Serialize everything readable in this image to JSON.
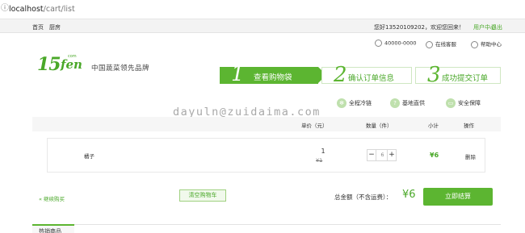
{
  "browser": {
    "url_host": "localhost",
    "url_path": "/cart/list"
  },
  "topnav": {
    "home": "首页",
    "kitchen": "厨房",
    "welcome": "您好13520109202，欢迎您回来！",
    "user_center": "用户中心",
    "logout": "退出"
  },
  "service": {
    "phone": "40000-0000",
    "chat": "在线客服",
    "help": "帮助中心"
  },
  "logo": {
    "number": "15",
    "brand": "fen",
    "domain": "com",
    "slogan": "中国蔬菜领先品牌"
  },
  "steps": [
    {
      "num": "1",
      "label": "查看购物袋"
    },
    {
      "num": "2",
      "label": "确认订单信息"
    },
    {
      "num": "3",
      "label": "成功提交订单"
    }
  ],
  "features": {
    "cold_chain": "全程冷链",
    "farm_direct": "基地直供",
    "safety": "安全保障"
  },
  "watermark": "dayuln@zuidaima.com",
  "table": {
    "headers": {
      "price": "单价（元）",
      "qty": "数量（件）",
      "subtotal": "小计",
      "op": "操作"
    },
    "rows": [
      {
        "name": "橘子",
        "price": "1",
        "original_price": "¥1",
        "qty": "6",
        "subtotal": "¥6",
        "delete": "删除"
      }
    ]
  },
  "cart": {
    "continue": "« 继续购买",
    "clear": "清空购物车",
    "total_label": "总金额（不含运费）：",
    "total_value": "¥6",
    "checkout": "立即结算"
  },
  "hot_tab": "热销商品",
  "colors": {
    "brand_green": "#5cb531"
  }
}
